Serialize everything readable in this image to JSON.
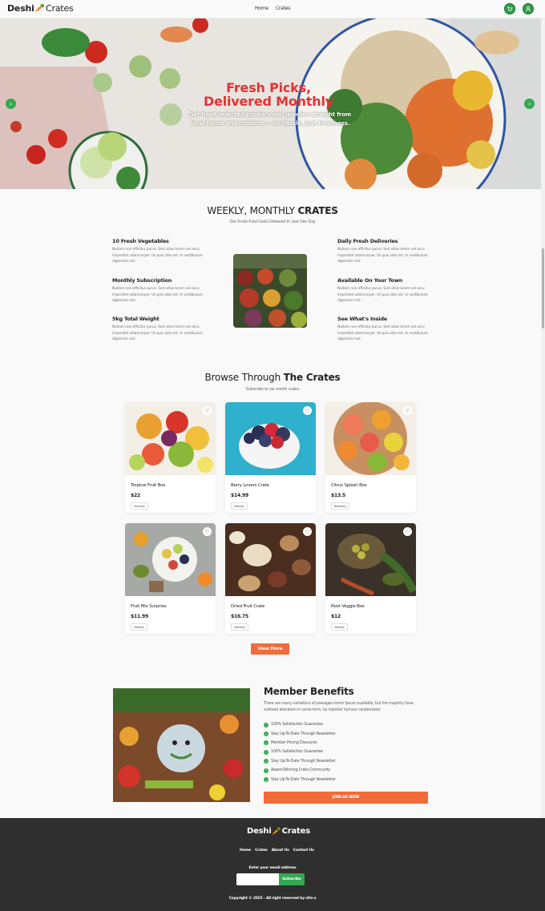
{
  "nav": {
    "logo_part1": "Deshi",
    "logo_part2": "Crates",
    "links": [
      "Home",
      "Crates"
    ],
    "icons": [
      "cart-icon",
      "user-icon"
    ]
  },
  "hero": {
    "title": "Fresh Picks, Delivered Monthly",
    "subtitle": "Get hand-selected produce and goodies straight from local farms and creators — no hassle, just freshness."
  },
  "weekly": {
    "title_light": "WEEKLY, MONTHLY",
    "title_bold": "CRATES",
    "subtitle": "Our Fresh Food Gets Delivered In Just One Day",
    "features_left": [
      {
        "title": "10 Fresh Vegetables",
        "text": "Nullam non efficitur purus. Sed vitae lorem vel arcu imperdiet ullamcorper. Ut quis odio est. In vestibulum dignissim nisl."
      },
      {
        "title": "Monthly Subscription",
        "text": "Nullam non efficitur purus. Sed vitae lorem vel arcu imperdiet ullamcorper. Ut quis odio est. In vestibulum dignissim nisl."
      },
      {
        "title": "5kg Total Weight",
        "text": "Nullam non efficitur purus. Sed vitae lorem vel arcu imperdiet ullamcorper. Ut quis odio est. In vestibulum dignissim nisl."
      }
    ],
    "features_right": [
      {
        "title": "Daily Fresh Deliveries",
        "text": "Nullam non efficitur purus. Sed vitae lorem vel arcu imperdiet ullamcorper. Ut quis odio est. In vestibulum dignissim nisl."
      },
      {
        "title": "Available On Your Town",
        "text": "Nullam non efficitur purus. Sed vitae lorem vel arcu imperdiet ullamcorper. Ut quis odio est. In vestibulum dignissim nisl."
      },
      {
        "title": "See What's Inside",
        "text": "Nullam non efficitur purus. Sed vitae lorem vel arcu imperdiet ullamcorper. Ut quis odio est. In vestibulum dignissim nisl."
      }
    ]
  },
  "browse": {
    "title_light": "Browse Through",
    "title_bold": "The Crates",
    "subtitle": "Subscribe to our month crates",
    "products": [
      {
        "name": "Tropical Fruit Box",
        "price": "$22",
        "tag": "Monthly"
      },
      {
        "name": "Berry Lovers Crate",
        "price": "$14.99",
        "tag": "Weekly"
      },
      {
        "name": "Citrus Splash Box",
        "price": "$13.5",
        "tag": "Biweekly"
      },
      {
        "name": "Fruit Mix Surprise",
        "price": "$11.99",
        "tag": "Weekly"
      },
      {
        "name": "Dried Fruit Crate",
        "price": "$16.75",
        "tag": "Monthly"
      },
      {
        "name": "Root Veggie Box",
        "price": "$12",
        "tag": "Weekly"
      }
    ],
    "view_more": "View More"
  },
  "benefits": {
    "title": "Member Benefits",
    "desc": "There are many variations of passages lorem Ipsum available, but the majority have suffered alteration in some form, by injected humour randomised.",
    "items": [
      "100% Satisfaction Guarantee",
      "Stay Up-To-Date Through Newsletter",
      "Member Pricing Discounts",
      "100% Satisfaction Guarantee",
      "Stay Up-To-Date Through Newsletter",
      "Award-Winning Crate Community",
      "Stay Up-To-Date Through Newsletter"
    ],
    "join": "JOIN US NOW"
  },
  "footer": {
    "logo_part1": "Deshi",
    "logo_part2": "Crates",
    "links": [
      "Home",
      "Crates",
      "About Us",
      "Contact Us"
    ],
    "email_label": "Enter your email address",
    "email_placeholder": "",
    "subscribe": "Subscribe",
    "copyright": "Copyright © 2025 - All right reserved by site-x"
  },
  "colors": {
    "accent": "#f26b3a",
    "green": "#34a853",
    "title_red": "#e53232",
    "footer_bg": "#2f2f2f"
  }
}
